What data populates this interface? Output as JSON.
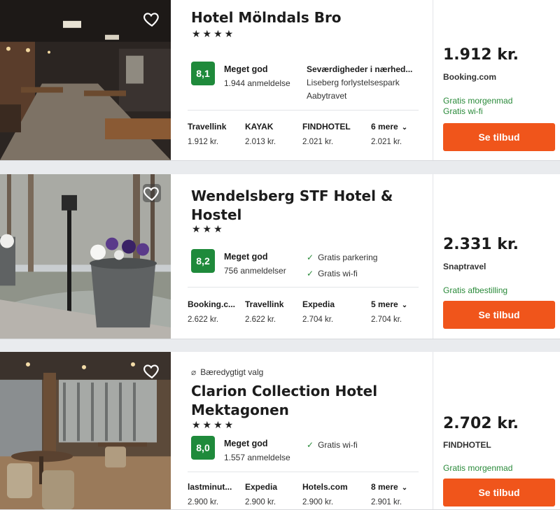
{
  "hotels": [
    {
      "name": "Hotel Mölndals Bro",
      "stars": "★★★★",
      "score": "8,1",
      "rating_label": "Meget god",
      "reviews": "1.944 anmeldelse",
      "amenities_head": "Seværdigheder i nærhed...",
      "amenities": [
        "Liseberg forlystelsespark",
        "Aabytravet"
      ],
      "providers": [
        {
          "name": "Travellink",
          "price": "1.912 kr."
        },
        {
          "name": "KAYAK",
          "price": "2.013 kr."
        },
        {
          "name": "FINDHOTEL",
          "price": "2.021 kr."
        },
        {
          "name": "6 mere",
          "price": "2.021 kr."
        }
      ],
      "price": "1.912 kr.",
      "site": "Booking.com",
      "perks": [
        "Gratis morgenmad",
        "Gratis wi-fi"
      ],
      "button": "Se tilbud"
    },
    {
      "name": "Wendelsberg STF Hotel & Hostel",
      "stars": "★★★",
      "score": "8,2",
      "rating_label": "Meget god",
      "reviews": "756 anmeldelser",
      "amenities": [
        "Gratis parkering",
        "Gratis wi-fi"
      ],
      "providers": [
        {
          "name": "Booking.c...",
          "price": "2.622 kr."
        },
        {
          "name": "Travellink",
          "price": "2.622 kr."
        },
        {
          "name": "Expedia",
          "price": "2.704 kr."
        },
        {
          "name": "5 mere",
          "price": "2.704 kr."
        }
      ],
      "price": "2.331 kr.",
      "site": "Snaptravel",
      "perks": [
        "Gratis afbestilling"
      ],
      "button": "Se tilbud"
    },
    {
      "eco_label": "Bæredygtigt valg",
      "name": "Clarion Collection Hotel Mektagonen",
      "stars": "★★★★",
      "score": "8,0",
      "rating_label": "Meget god",
      "reviews": "1.557 anmeldelse",
      "amenities": [
        "Gratis wi-fi"
      ],
      "providers": [
        {
          "name": "lastminut...",
          "price": "2.900 kr."
        },
        {
          "name": "Expedia",
          "price": "2.900 kr."
        },
        {
          "name": "Hotels.com",
          "price": "2.900 kr."
        },
        {
          "name": "8 mere",
          "price": "2.901 kr."
        }
      ],
      "price": "2.702 kr.",
      "site": "FINDHOTEL",
      "perks": [
        "Gratis morgenmad"
      ],
      "button": "Se tilbud"
    }
  ],
  "colors": {
    "score_green": "#1f8a3b",
    "perk_green": "#2a8a3a",
    "deal_orange": "#f0551b"
  },
  "icons": {
    "favorite": "heart-icon",
    "chevron": "chevron-down-icon",
    "check": "check-icon",
    "eco": "leaf-icon"
  }
}
